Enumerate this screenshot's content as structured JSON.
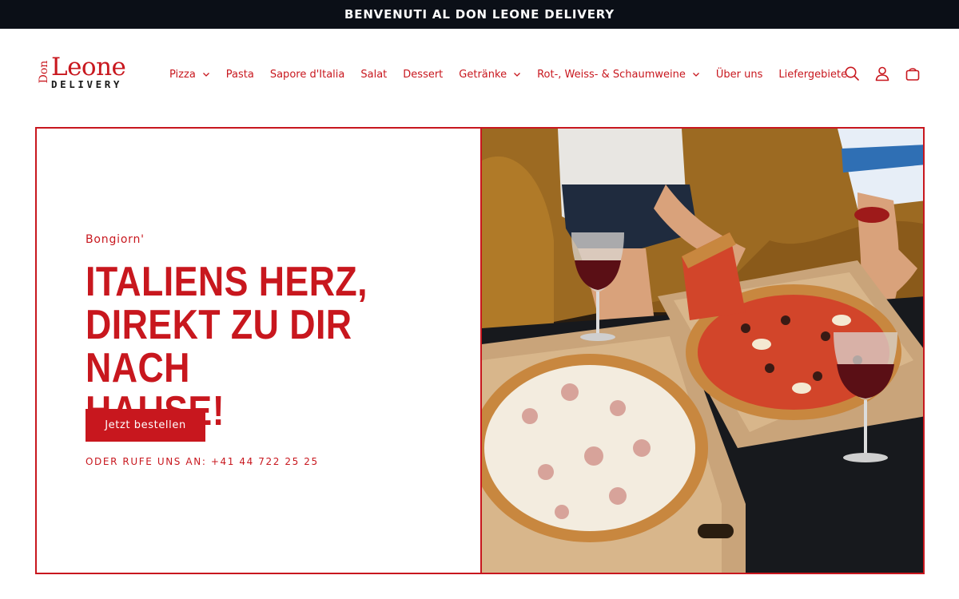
{
  "announcement": {
    "text": "BENVENUTI AL DON LEONE DELIVERY"
  },
  "logo": {
    "top": "Don",
    "main": "Leone",
    "sub": "DELIVERY"
  },
  "nav": {
    "items": [
      {
        "label": "Pizza",
        "has_dropdown": true
      },
      {
        "label": "Pasta",
        "has_dropdown": false
      },
      {
        "label": "Sapore d'Italia",
        "has_dropdown": false
      },
      {
        "label": "Salat",
        "has_dropdown": false
      },
      {
        "label": "Dessert",
        "has_dropdown": false
      },
      {
        "label": "Getränke",
        "has_dropdown": true
      },
      {
        "label": "Rot-, Weiss- & Schaumweine",
        "has_dropdown": true
      },
      {
        "label": "Über uns",
        "has_dropdown": false
      },
      {
        "label": "Liefergebiete",
        "has_dropdown": false
      }
    ]
  },
  "header_icons": [
    "search-icon",
    "account-icon",
    "cart-icon"
  ],
  "hero": {
    "eyebrow": "Bongiorn'",
    "headline_lines": [
      "ITALIENS HERZ,",
      "DIREKT ZU DIR NACH",
      "HAUSE!"
    ],
    "cta_label": "Jetzt bestellen",
    "phone_text": "ODER RUFE UNS AN: +41 44 722 25 25"
  },
  "colors": {
    "brand_red": "#c8171e",
    "announcement_bg": "#0b0f17",
    "background": "#ffffff"
  }
}
